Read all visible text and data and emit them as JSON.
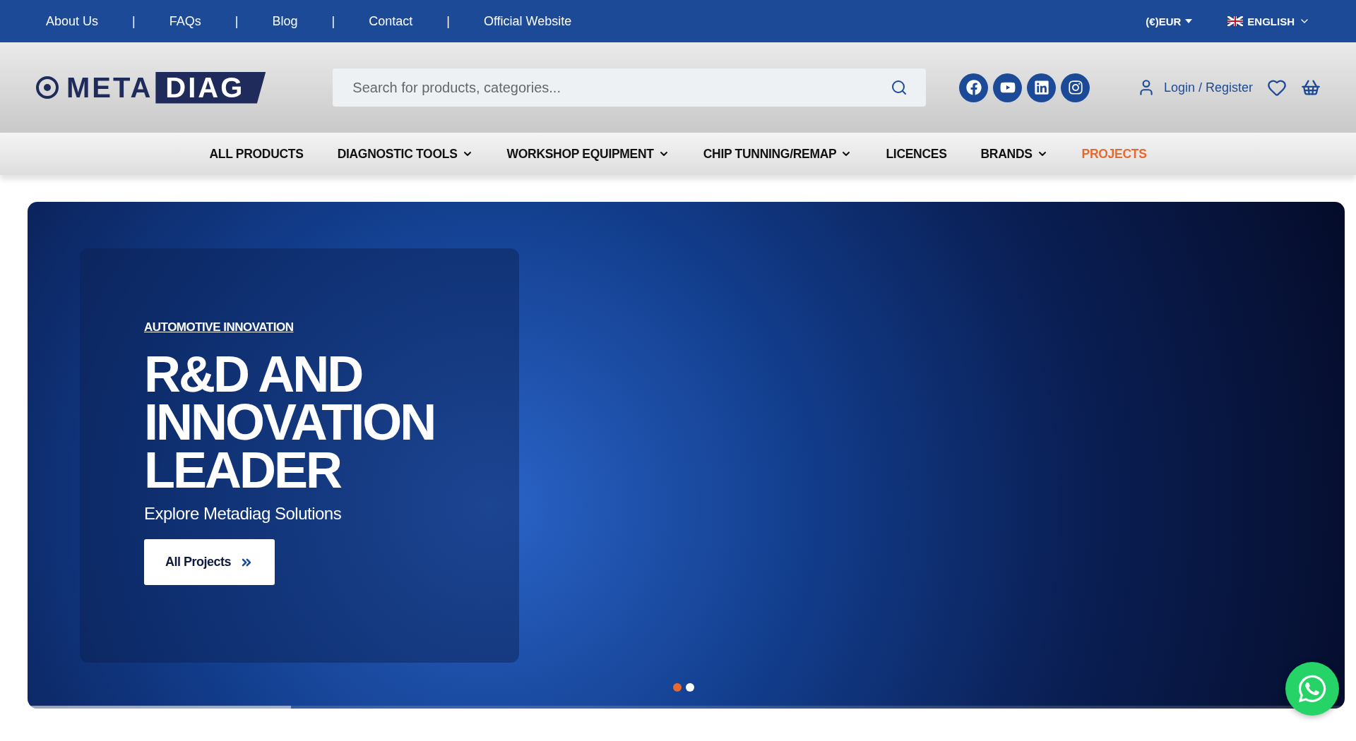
{
  "top_links": [
    "About Us",
    "FAQs",
    "Blog",
    "Contact",
    "Official Website"
  ],
  "separator": "|",
  "currency": "(€)EUR",
  "language": "ENGLISH",
  "logo": {
    "first": "META",
    "second": "DIAG"
  },
  "search": {
    "placeholder": "Search for products, categories..."
  },
  "social": [
    {
      "kind": "facebook"
    },
    {
      "kind": "youtube"
    },
    {
      "kind": "linkedin"
    },
    {
      "kind": "instagram"
    }
  ],
  "account": "Login / Register",
  "nav": [
    {
      "label": "ALL PRODUCTS",
      "has_menu": false,
      "selected": false
    },
    {
      "label": "DIAGNOSTIC TOOLS",
      "has_menu": true,
      "selected": false
    },
    {
      "label": "WORKSHOP EQUIPMENT",
      "has_menu": true,
      "selected": false
    },
    {
      "label": "CHIP TUNNING/REMAP",
      "has_menu": true,
      "selected": false
    },
    {
      "label": "LICENCES",
      "has_menu": false,
      "selected": false
    },
    {
      "label": "BRANDS",
      "has_menu": true,
      "selected": false
    },
    {
      "label": "PROJECTS",
      "has_menu": false,
      "selected": true
    }
  ],
  "hero": {
    "eyebrow": "AUTOMOTIVE INNOVATION",
    "heading": [
      "R&D AND",
      "INNOVATION",
      "LEADER"
    ],
    "subtitle": "Explore Metadiag Solutions",
    "button": "All Projects",
    "slides": [
      {
        "selected": true
      },
      {
        "selected": false
      }
    ],
    "progress": {
      "level": 0.2
    }
  }
}
